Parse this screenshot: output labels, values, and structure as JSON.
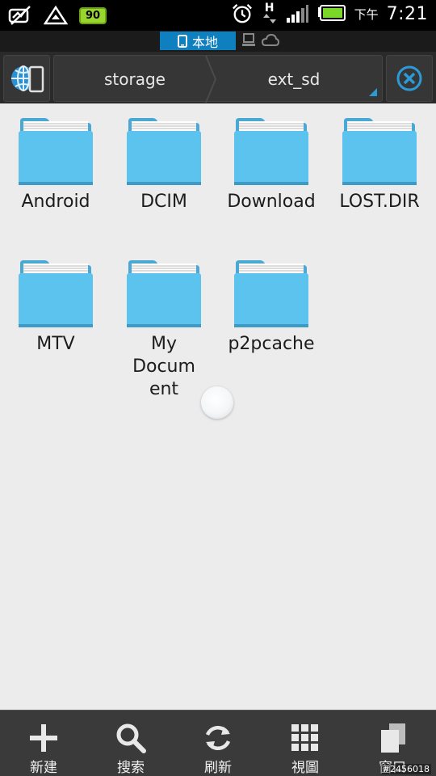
{
  "status_bar": {
    "battery_badge": "90",
    "clock_prefix": "下午",
    "time": "7:21",
    "network_letter": "H"
  },
  "location_tabs": {
    "local_label": "本地"
  },
  "path": {
    "crumbs": [
      "storage",
      "ext_sd"
    ]
  },
  "folders": [
    {
      "name": "Android"
    },
    {
      "name": "DCIM"
    },
    {
      "name": "Download"
    },
    {
      "name": "LOST.DIR"
    },
    {
      "name": "MTV"
    },
    {
      "name": "My Document"
    },
    {
      "name": "p2pcache"
    }
  ],
  "toolbar": {
    "new_label": "新建",
    "search_label": "搜索",
    "refresh_label": "刷新",
    "view_label": "視圖",
    "windows_label": "窗口"
  },
  "watermark": "#2456018",
  "colors": {
    "accent": "#0e7fbf",
    "folder": "#5cc2ee"
  }
}
